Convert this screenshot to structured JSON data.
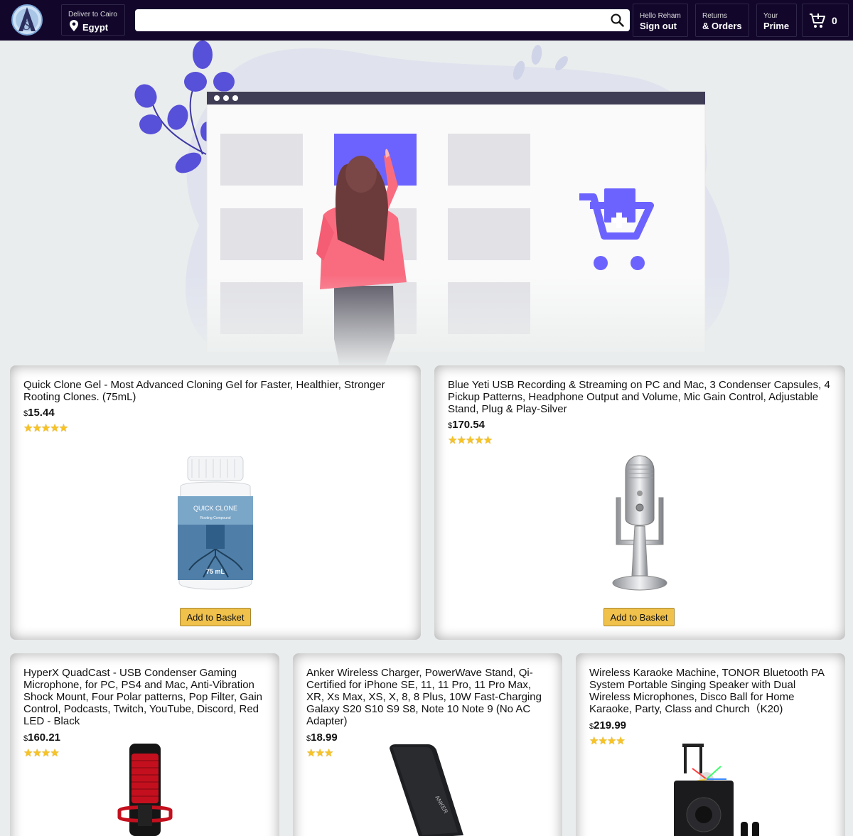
{
  "header": {
    "deliver_line1": "Deliver to Cairo",
    "deliver_line2": "Egypt",
    "search_value": "",
    "nav": [
      {
        "line1": "Hello Reham",
        "line2": "Sign out"
      },
      {
        "line1": "Returns",
        "line2": "& Orders"
      },
      {
        "line1": "Your",
        "line2": "Prime"
      }
    ],
    "cart_count": "0",
    "logo_letter": "S"
  },
  "icons": [
    "logo-icon",
    "location-pin-icon",
    "search-icon",
    "cart-icon"
  ],
  "colors": {
    "header_bg": "#12062b",
    "accent": "#6c63ff",
    "button": "#f0c14b",
    "star": "#f7c325",
    "hero_person": "#f96c80"
  },
  "products": [
    {
      "title": "Quick Clone Gel - Most Advanced Cloning Gel for Faster, Healthier, Stronger Rooting Clones. (75mL)",
      "currency": "$",
      "price": "15.44",
      "rating": 5,
      "stars": "★★★★★",
      "button": "Add to Basket",
      "image_labels": [
        "QUICK CLONE",
        "Rooting Compound",
        "75 mL"
      ]
    },
    {
      "title": "Blue Yeti USB Recording & Streaming on PC and Mac, 3 Condenser Capsules, 4 Pickup Patterns, Headphone Output and Volume, Mic Gain Control, Adjustable Stand, Plug & Play-Silver",
      "currency": "$",
      "price": "170.54",
      "rating": 5,
      "stars": "★★★★★",
      "button": "Add to Basket"
    },
    {
      "title": "HyperX QuadCast - USB Condenser Gaming Microphone, for PC, PS4 and Mac, Anti-Vibration Shock Mount, Four Polar patterns, Pop Filter, Gain Control, Podcasts, Twitch, YouTube, Discord, Red LED - Black",
      "currency": "$",
      "price": "160.21",
      "rating": 4,
      "stars": "★★★★",
      "button": "Add to Basket"
    },
    {
      "title": "Anker Wireless Charger, PowerWave Stand, Qi-Certified for iPhone SE, 11, 11 Pro, 11 Pro Max, XR, Xs Max, XS, X, 8, 8 Plus, 10W Fast-Charging Galaxy S20 S10 S9 S8, Note 10 Note 9 (No AC Adapter)",
      "currency": "$",
      "price": "18.99",
      "rating": 3,
      "stars": "★★★",
      "button": "Add to Basket",
      "image_labels": [
        "ANKER"
      ]
    },
    {
      "title": "Wireless Karaoke Machine, TONOR Bluetooth PA System Portable Singing Speaker with Dual Wireless Microphones, Disco Ball for Home Karaoke, Party, Class and Church（K20)",
      "currency": "$",
      "price": "219.99",
      "rating": 4,
      "stars": "★★★★",
      "button": "Add to Basket"
    }
  ]
}
